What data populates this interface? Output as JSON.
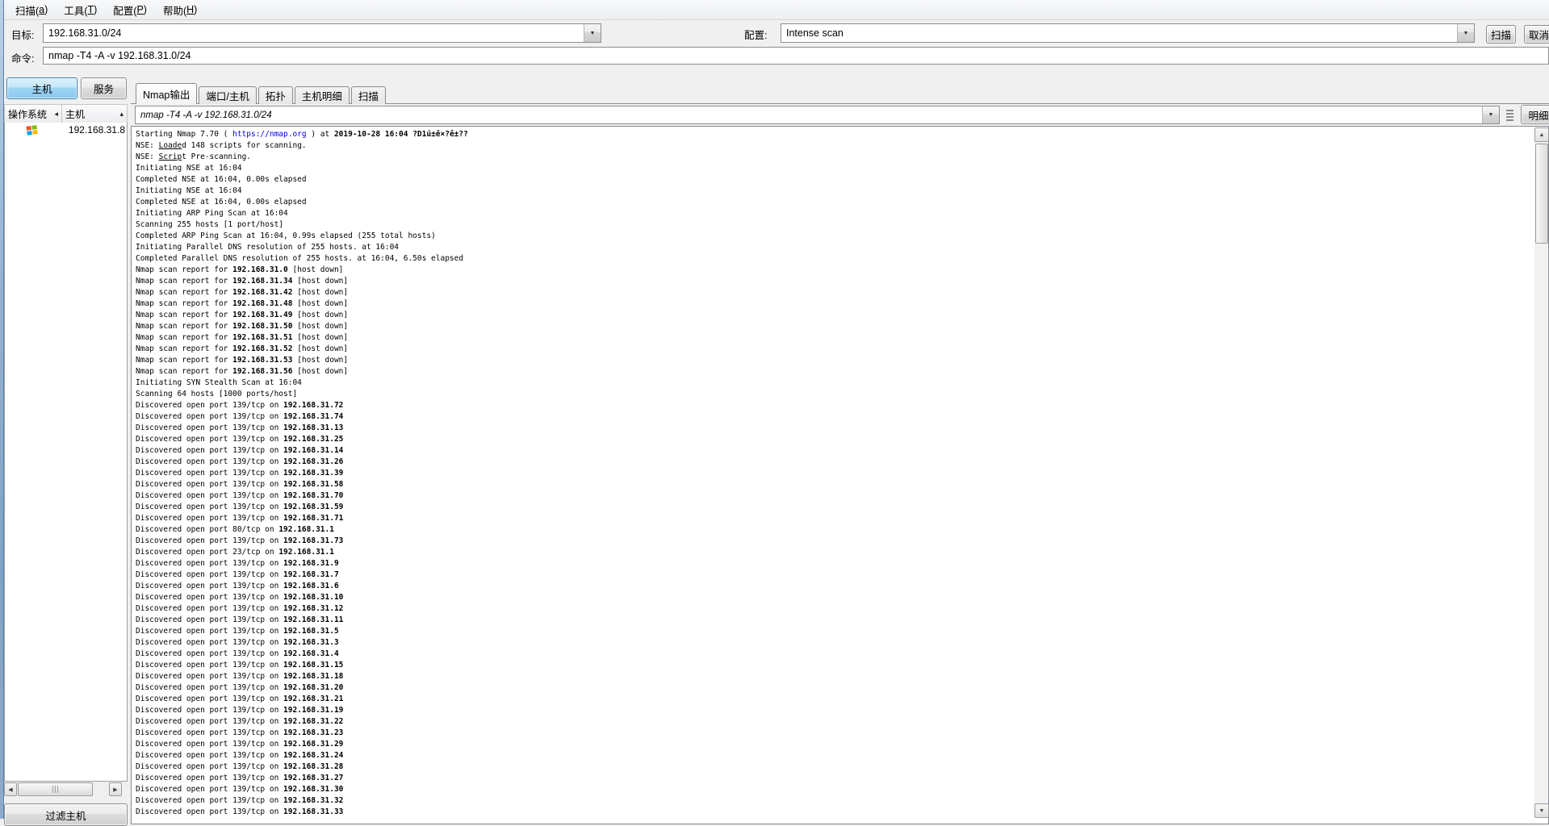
{
  "menu": {
    "items": [
      {
        "name": "scan-menu",
        "label": "扫描(a)"
      },
      {
        "name": "tools-menu",
        "label": "工具(T)"
      },
      {
        "name": "profile-menu",
        "label": "配置(P)"
      },
      {
        "name": "help-menu",
        "label": "帮助(H)"
      }
    ]
  },
  "target_row": {
    "target_label": "目标:",
    "target_value": "192.168.31.0/24",
    "profile_label": "配置:",
    "profile_value": "Intense scan",
    "scan_button": "扫描",
    "cancel_button": "取消"
  },
  "command_row": {
    "label": "命令:",
    "value": "nmap -T4 -A -v 192.168.31.0/24"
  },
  "sidebar": {
    "hosts_button": "主机",
    "services_button": "服务",
    "columns": {
      "os": "操作系统",
      "host": "主机"
    },
    "hosts": [
      {
        "ip": "192.168.31.8"
      }
    ],
    "filter_button": "过滤主机"
  },
  "tabs": [
    {
      "name": "tab-nmap-output",
      "label": "Nmap输出",
      "active": true
    },
    {
      "name": "tab-ports-hosts",
      "label": "端口/主机",
      "active": false
    },
    {
      "name": "tab-topology",
      "label": "拓扑",
      "active": false
    },
    {
      "name": "tab-host-details",
      "label": "主机明细",
      "active": false
    },
    {
      "name": "tab-scans",
      "label": "扫描",
      "active": false
    }
  ],
  "output_toolbar": {
    "command_value": "nmap -T4 -A -v 192.168.31.0/24",
    "details_button": "明细"
  },
  "icons": {
    "chevron_down": "▼",
    "sort_asc": "▴",
    "col_arrow": "◂",
    "scroll_up": "▲",
    "scroll_down": "▼",
    "scroll_left": "◀",
    "scroll_right": "▶"
  },
  "colors": {
    "accent_blue": "#3c7fb1",
    "selected_button_fill": "#a0d5f4",
    "link": "#0000e6",
    "window_bg": "#f0f0f0"
  },
  "output": {
    "lines": [
      [
        "Starting Nmap 7.70 ( ",
        [
          "https://nmap.org",
          "link"
        ],
        " ) at ",
        [
          "2019-10-28 16:04",
          "b"
        ],
        [
          " ?D1ú±ê×?ê±??",
          "b"
        ]
      ],
      [
        "NSE: ",
        [
          "Loade",
          "u"
        ],
        "d 148 scripts for scanning."
      ],
      [
        "NSE: ",
        [
          "Scrip",
          "u"
        ],
        "t Pre-scanning."
      ],
      [
        "Initiating NSE at 16:04"
      ],
      [
        "Completed NSE at 16:04, 0.00s elapsed"
      ],
      [
        "Initiating NSE at 16:04"
      ],
      [
        "Completed NSE at 16:04, 0.00s elapsed"
      ],
      [
        "Initiating ARP Ping Scan at 16:04"
      ],
      [
        "Scanning 255 hosts [1 port/host]"
      ],
      [
        "Completed ARP Ping Scan at 16:04, 0.99s elapsed (255 total hosts)"
      ],
      [
        "Initiating Parallel DNS resolution of 255 hosts. at 16:04"
      ],
      [
        "Completed Parallel DNS resolution of 255 hosts. at 16:04, 6.50s elapsed"
      ],
      [
        "Nmap scan report for ",
        [
          "192.168.31.0",
          "b"
        ],
        " [host down]"
      ],
      [
        "Nmap scan report for ",
        [
          "192.168.31.34",
          "b"
        ],
        " [host down]"
      ],
      [
        "Nmap scan report for ",
        [
          "192.168.31.42",
          "b"
        ],
        " [host down]"
      ],
      [
        "Nmap scan report for ",
        [
          "192.168.31.48",
          "b"
        ],
        " [host down]"
      ],
      [
        "Nmap scan report for ",
        [
          "192.168.31.49",
          "b"
        ],
        " [host down]"
      ],
      [
        "Nmap scan report for ",
        [
          "192.168.31.50",
          "b"
        ],
        " [host down]"
      ],
      [
        "Nmap scan report for ",
        [
          "192.168.31.51",
          "b"
        ],
        " [host down]"
      ],
      [
        "Nmap scan report for ",
        [
          "192.168.31.52",
          "b"
        ],
        " [host down]"
      ],
      [
        "Nmap scan report for ",
        [
          "192.168.31.53",
          "b"
        ],
        " [host down]"
      ],
      [
        "Nmap scan report for ",
        [
          "192.168.31.56",
          "b"
        ],
        " [host down]"
      ],
      [
        "Initiating SYN Stealth Scan at 16:04"
      ],
      [
        "Scanning 64 hosts [1000 ports/host]"
      ],
      [
        "Discovered open port 139/tcp on ",
        [
          "192.168.31.72",
          "b"
        ]
      ],
      [
        "Discovered open port 139/tcp on ",
        [
          "192.168.31.74",
          "b"
        ]
      ],
      [
        "Discovered open port 139/tcp on ",
        [
          "192.168.31.13",
          "b"
        ]
      ],
      [
        "Discovered open port 139/tcp on ",
        [
          "192.168.31.25",
          "b"
        ]
      ],
      [
        "Discovered open port 139/tcp on ",
        [
          "192.168.31.14",
          "b"
        ]
      ],
      [
        "Discovered open port 139/tcp on ",
        [
          "192.168.31.26",
          "b"
        ]
      ],
      [
        "Discovered open port 139/tcp on ",
        [
          "192.168.31.39",
          "b"
        ]
      ],
      [
        "Discovered open port 139/tcp on ",
        [
          "192.168.31.58",
          "b"
        ]
      ],
      [
        "Discovered open port 139/tcp on ",
        [
          "192.168.31.70",
          "b"
        ]
      ],
      [
        "Discovered open port 139/tcp on ",
        [
          "192.168.31.59",
          "b"
        ]
      ],
      [
        "Discovered open port 139/tcp on ",
        [
          "192.168.31.71",
          "b"
        ]
      ],
      [
        "Discovered open port 80/tcp on ",
        [
          "192.168.31.1",
          "b"
        ]
      ],
      [
        "Discovered open port 139/tcp on ",
        [
          "192.168.31.73",
          "b"
        ]
      ],
      [
        "Discovered open port 23/tcp on ",
        [
          "192.168.31.1",
          "b"
        ]
      ],
      [
        "Discovered open port 139/tcp on ",
        [
          "192.168.31.9",
          "b"
        ]
      ],
      [
        "Discovered open port 139/tcp on ",
        [
          "192.168.31.7",
          "b"
        ]
      ],
      [
        "Discovered open port 139/tcp on ",
        [
          "192.168.31.6",
          "b"
        ]
      ],
      [
        "Discovered open port 139/tcp on ",
        [
          "192.168.31.10",
          "b"
        ]
      ],
      [
        "Discovered open port 139/tcp on ",
        [
          "192.168.31.12",
          "b"
        ]
      ],
      [
        "Discovered open port 139/tcp on ",
        [
          "192.168.31.11",
          "b"
        ]
      ],
      [
        "Discovered open port 139/tcp on ",
        [
          "192.168.31.5",
          "b"
        ]
      ],
      [
        "Discovered open port 139/tcp on ",
        [
          "192.168.31.3",
          "b"
        ]
      ],
      [
        "Discovered open port 139/tcp on ",
        [
          "192.168.31.4",
          "b"
        ]
      ],
      [
        "Discovered open port 139/tcp on ",
        [
          "192.168.31.15",
          "b"
        ]
      ],
      [
        "Discovered open port 139/tcp on ",
        [
          "192.168.31.18",
          "b"
        ]
      ],
      [
        "Discovered open port 139/tcp on ",
        [
          "192.168.31.20",
          "b"
        ]
      ],
      [
        "Discovered open port 139/tcp on ",
        [
          "192.168.31.21",
          "b"
        ]
      ],
      [
        "Discovered open port 139/tcp on ",
        [
          "192.168.31.19",
          "b"
        ]
      ],
      [
        "Discovered open port 139/tcp on ",
        [
          "192.168.31.22",
          "b"
        ]
      ],
      [
        "Discovered open port 139/tcp on ",
        [
          "192.168.31.23",
          "b"
        ]
      ],
      [
        "Discovered open port 139/tcp on ",
        [
          "192.168.31.29",
          "b"
        ]
      ],
      [
        "Discovered open port 139/tcp on ",
        [
          "192.168.31.24",
          "b"
        ]
      ],
      [
        "Discovered open port 139/tcp on ",
        [
          "192.168.31.28",
          "b"
        ]
      ],
      [
        "Discovered open port 139/tcp on ",
        [
          "192.168.31.27",
          "b"
        ]
      ],
      [
        "Discovered open port 139/tcp on ",
        [
          "192.168.31.30",
          "b"
        ]
      ],
      [
        "Discovered open port 139/tcp on ",
        [
          "192.168.31.32",
          "b"
        ]
      ],
      [
        "Discovered open port 139/tcp on ",
        [
          "192.168.31.33",
          "b"
        ]
      ]
    ]
  }
}
